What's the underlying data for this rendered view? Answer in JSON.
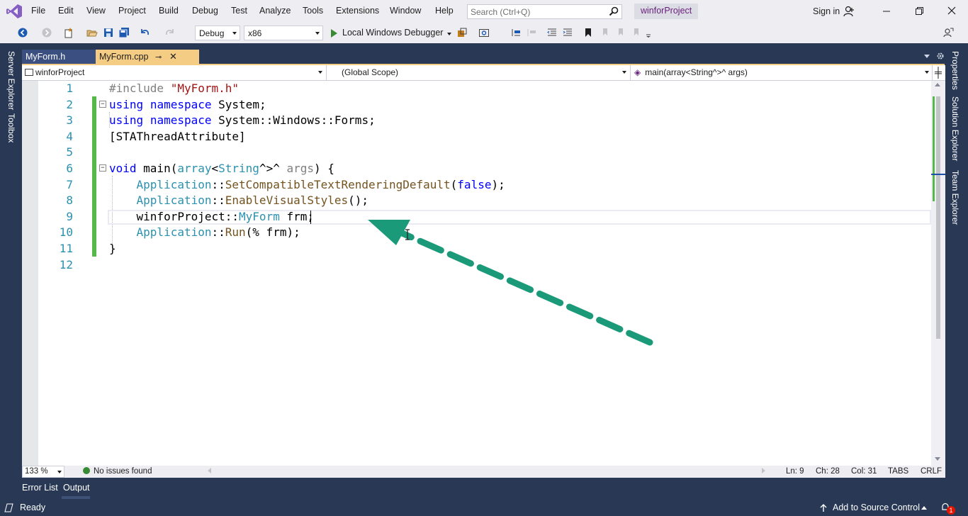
{
  "menu": {
    "items": [
      "File",
      "Edit",
      "View",
      "Project",
      "Build",
      "Debug",
      "Test",
      "Analyze",
      "Tools",
      "Extensions",
      "Window",
      "Help"
    ],
    "search_placeholder": "Search (Ctrl+Q)",
    "project_name": "winforProject",
    "sign_in": "Sign in"
  },
  "toolbar": {
    "configuration": "Debug",
    "platform": "x86",
    "run_label": "Local Windows Debugger"
  },
  "side_tabs": {
    "left": [
      "Server Explorer",
      "Toolbox"
    ],
    "right": [
      "Properties",
      "Solution Explorer",
      "Team Explorer"
    ]
  },
  "doc_tabs": [
    {
      "label": "MyForm.h",
      "active": false
    },
    {
      "label": "MyForm.cpp",
      "active": true
    }
  ],
  "navbar": {
    "project": "winforProject",
    "scope": "(Global Scope)",
    "member": "main(array<String^>^ args)"
  },
  "editor": {
    "line_numbers": [
      "1",
      "2",
      "3",
      "4",
      "5",
      "6",
      "7",
      "8",
      "9",
      "10",
      "11",
      "12"
    ],
    "lines": [
      "#include \"MyForm.h\"",
      "using namespace System;",
      "using namespace System::Windows::Forms;",
      "[STAThreadAttribute]",
      "",
      "void main(array<String^>^ args) {",
      "    Application::SetCompatibleTextRenderingDefault(false);",
      "    Application::EnableVisualStyles();",
      "    winforProject::MyForm frm;",
      "    Application::Run(% frm);",
      "}",
      ""
    ],
    "current_line": 9
  },
  "editor_status": {
    "zoom": "133 %",
    "issues": "No issues found",
    "line": "Ln: 9",
    "char": "Ch: 28",
    "col": "Col: 31",
    "tabs": "TABS",
    "eol": "CRLF"
  },
  "bottom_tabs": [
    "Error List",
    "Output"
  ],
  "statusbar": {
    "state": "Ready",
    "source_control": "Add to Source Control",
    "notifications": "1"
  },
  "colors": {
    "frame": "#293955",
    "active_tab": "#f5cc84",
    "change_marker": "#57b84a",
    "annotation_arrow": "#1a9a78",
    "keyword": "#0000ff",
    "type": "#2b91af",
    "string": "#a31515"
  }
}
